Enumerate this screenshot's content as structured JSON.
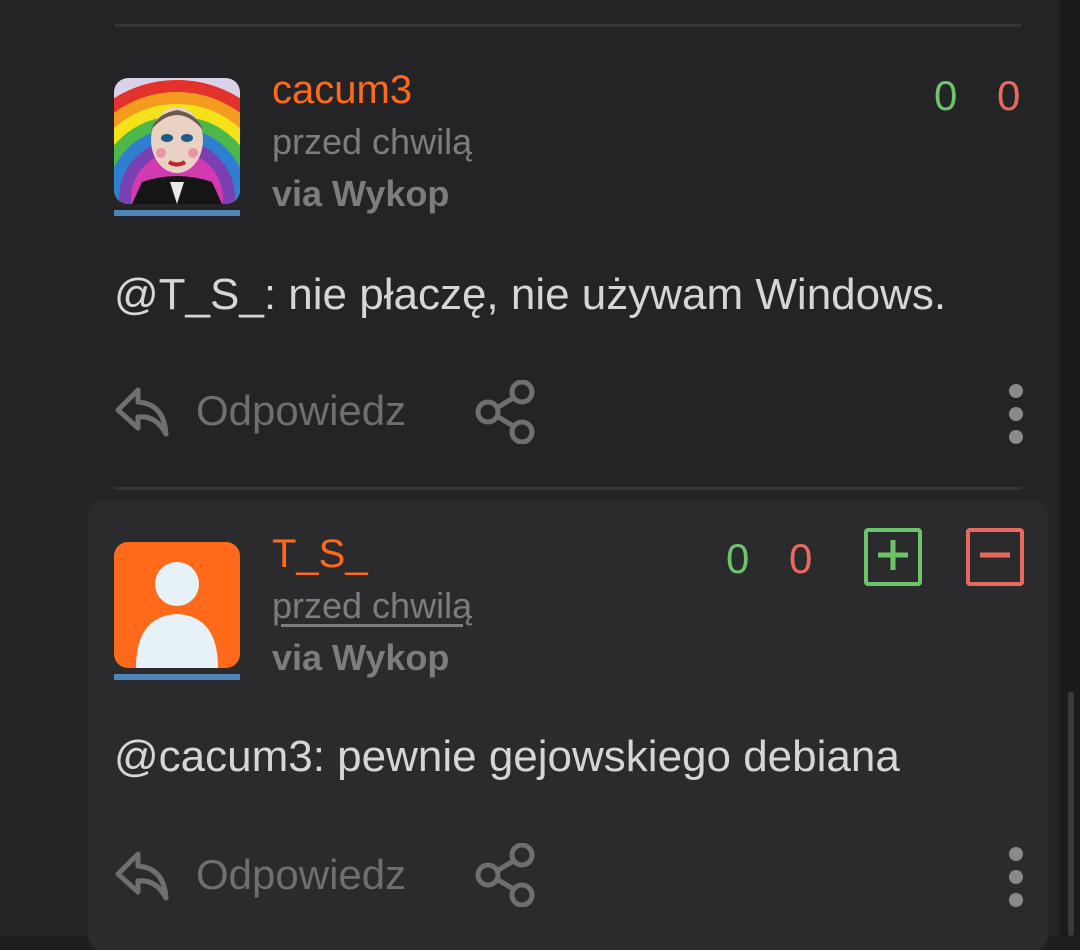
{
  "comments": [
    {
      "username": "cacum3",
      "time": "przed chwilą",
      "via": "via Wykop",
      "votes_up": "0",
      "votes_down": "0",
      "text": "@T_S_: nie płaczę, nie używam Windows.",
      "reply_label": "Odpowiedz",
      "avatar": "rainbow-portrait-image"
    },
    {
      "username": "T_S_",
      "time": "przed chwilą",
      "via": "via Wykop",
      "votes_up": "0",
      "votes_down": "0",
      "text": "@cacum3: pewnie gejowskiego debiana",
      "reply_label": "Odpowiedz",
      "avatar": "default-user-avatar"
    }
  ],
  "colors": {
    "background": "#242426",
    "username": "#ff6a1a",
    "upvote": "#6cc46b",
    "downvote": "#e86a5f",
    "avatar_underline": "#4f84b8"
  },
  "icons": [
    "reply-icon",
    "share-icon",
    "more-vertical-icon",
    "plus-icon",
    "minus-icon"
  ]
}
